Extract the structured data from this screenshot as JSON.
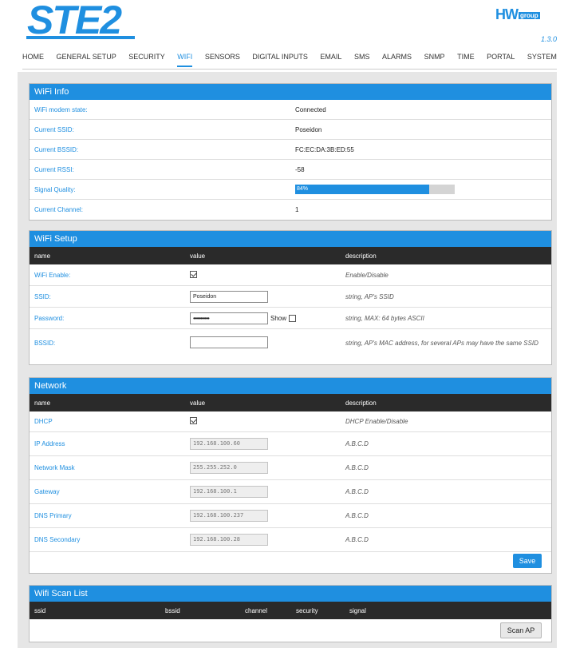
{
  "header": {
    "logo": "STE2",
    "brand": "HW",
    "brand_suffix": "group",
    "version": "1.3.0"
  },
  "nav": [
    "HOME",
    "GENERAL SETUP",
    "SECURITY",
    "WIFI",
    "SENSORS",
    "DIGITAL INPUTS",
    "EMAIL",
    "SMS",
    "ALARMS",
    "SNMP",
    "TIME",
    "PORTAL",
    "SYSTEM"
  ],
  "nav_active": "WIFI",
  "wifi_info": {
    "title": "WiFi Info",
    "rows": [
      {
        "label": "WiFi modem state:",
        "value": "Connected"
      },
      {
        "label": "Current SSID:",
        "value": "Poseidon"
      },
      {
        "label": "Current BSSID:",
        "value": "FC:EC:DA:3B:ED:55"
      },
      {
        "label": "Current RSSI:",
        "value": "-58"
      }
    ],
    "signal_label": "Signal Quality:",
    "signal_text": "84%",
    "signal_value": 0.84,
    "channel_label": "Current Channel:",
    "channel_value": "1"
  },
  "wifi_setup": {
    "title": "WiFi Setup",
    "headers": [
      "name",
      "value",
      "description"
    ],
    "enable_label": "WiFi Enable:",
    "enable_desc": "Enable/Disable",
    "ssid_label": "SSID:",
    "ssid_value": "Poseidon",
    "ssid_desc": "string, AP's SSID",
    "password_label": "Password:",
    "password_value": "•••••••••••",
    "show_label": "Show",
    "password_desc": "string, MAX: 64 bytes ASCII",
    "bssid_label": "BSSID:",
    "bssid_value": "",
    "bssid_desc": "string, AP's MAC address, for several APs may have the same SSID"
  },
  "network": {
    "title": "Network",
    "headers": [
      "name",
      "value",
      "description"
    ],
    "dhcp_label": "DHCP",
    "dhcp_desc": "DHCP Enable/Disable",
    "rows": [
      {
        "label": "IP Address",
        "value": "192.168.100.60",
        "desc": "A.B.C.D"
      },
      {
        "label": "Network Mask",
        "value": "255.255.252.0",
        "desc": "A.B.C.D"
      },
      {
        "label": "Gateway",
        "value": "192.168.100.1",
        "desc": "A.B.C.D"
      },
      {
        "label": "DNS Primary",
        "value": "192.168.100.237",
        "desc": "A.B.C.D"
      },
      {
        "label": "DNS Secondary",
        "value": "192.168.100.28",
        "desc": "A.B.C.D"
      }
    ],
    "save_label": "Save"
  },
  "scan": {
    "title": "Wifi Scan List",
    "headers": [
      "ssid",
      "bssid",
      "channel",
      "security",
      "signal"
    ],
    "scan_label": "Scan AP"
  }
}
